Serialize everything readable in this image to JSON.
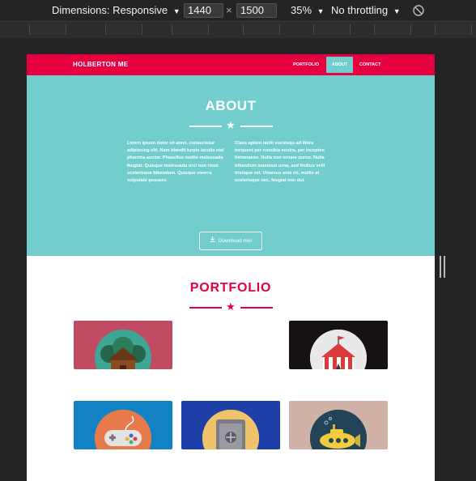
{
  "devtools": {
    "dimensions_label": "Dimensions: Responsive",
    "width_value": "1440",
    "times_sign": "×",
    "height_value": "1500",
    "zoom_label": "35%",
    "throttle_label": "No throttling",
    "caret": "▼"
  },
  "nav": {
    "brand": "HOLBERTON ME",
    "links": [
      "PORTFOLIO",
      "ABOUT",
      "CONTACT"
    ],
    "active_link": "ABOUT",
    "background": "#e6003f",
    "active_color": "#72cdcd"
  },
  "about": {
    "title": "ABOUT",
    "star": "★",
    "col1": "Lorem ipsum dolor sit amet, consectetur adipiscing elit. Nam blandit turpis iaculis nisl pharetra auctor. Phasellus mattis malesuada feugiat. Quisque malesuada orci non risus scelerisque bibendum. Quisque viverra vulputate posuere.",
    "col2": "Class aptent taciti sociosqu ad litora torquent per conubia nostra, per inceptos himenaeos. Nulla non ornare purus. Nulla bibendum maximus urna, sed finibus velit tristique vel. Vivamus ante mi, mollis at scelerisque nec, feugiat non dui.",
    "download_label": "Download me!",
    "download_icon": "download-icon",
    "background": "#72cdcd"
  },
  "portfolio": {
    "title": "PORTFOLIO",
    "star": "★",
    "accent": "#e6003f",
    "items": [
      {
        "icon": "cabin-icon",
        "bg": "#c24b64"
      },
      {
        "icon": "circus-tent-icon",
        "bg": "#161212"
      },
      {
        "icon": "gamepad-icon",
        "bg": "#1282c4"
      },
      {
        "icon": "safe-icon",
        "bg": "#1e3fa8"
      },
      {
        "icon": "submarine-icon",
        "bg": "#d0b2a6"
      }
    ]
  }
}
